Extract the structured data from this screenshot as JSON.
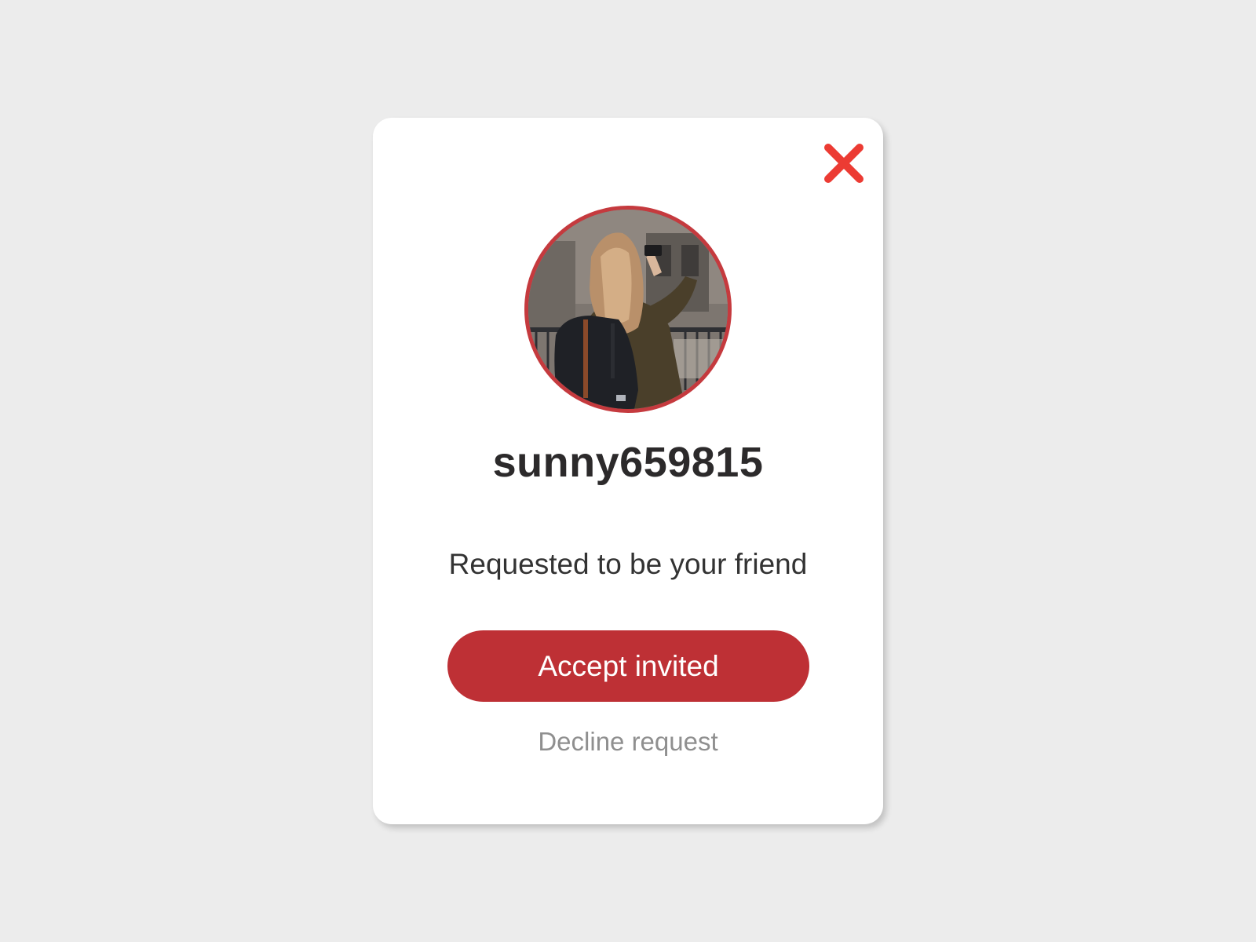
{
  "modal": {
    "close_icon": "close-icon",
    "avatar_description": "avatar photo",
    "username": "sunny659815",
    "message": "Requested to be your friend",
    "accept_label": "Accept invited",
    "decline_label": "Decline request"
  },
  "colors": {
    "background": "#ececec",
    "card": "#ffffff",
    "accent": "#be3035",
    "close_icon": "#ec3b33",
    "avatar_ring": "#c53a3e",
    "username_text": "#2c2a2b",
    "message_text": "#333333",
    "decline_text": "#8f8f8f"
  }
}
